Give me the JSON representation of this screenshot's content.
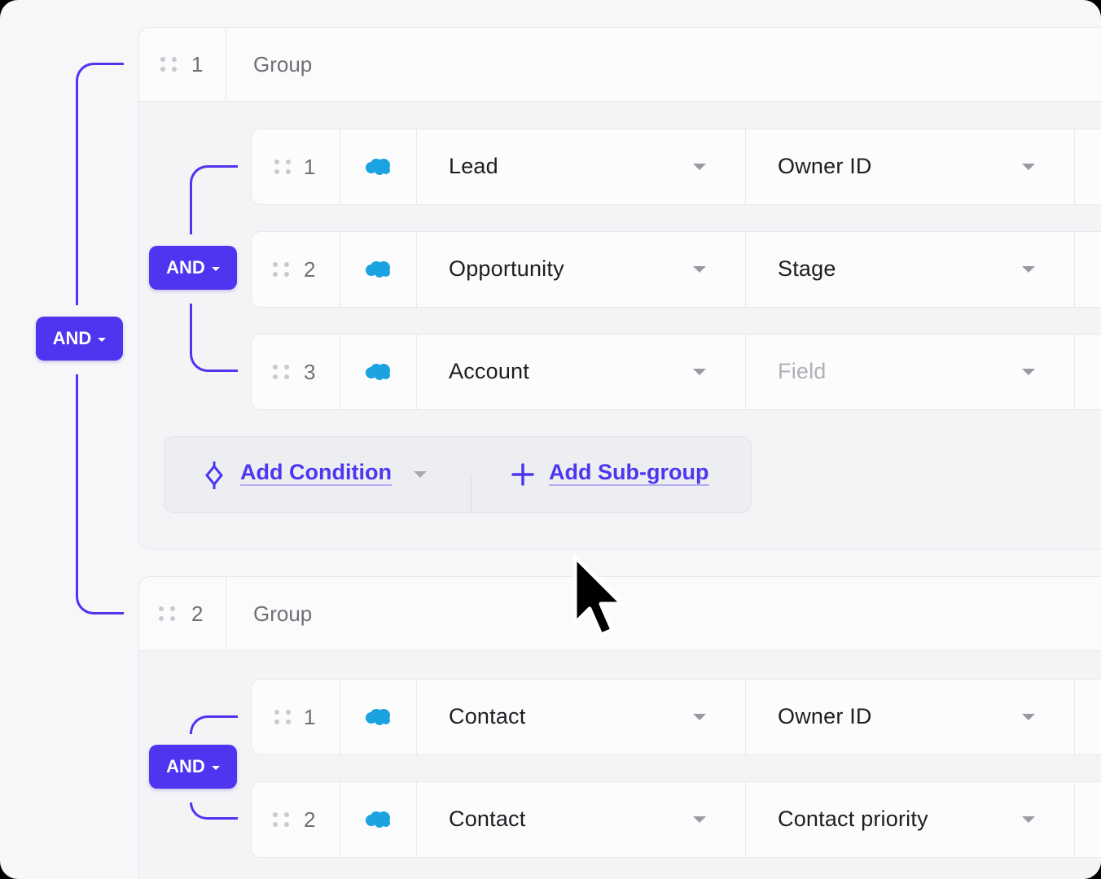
{
  "operators": {
    "root": "AND",
    "group1": "AND",
    "group2": "AND"
  },
  "groups": [
    {
      "number": "1",
      "label": "Group",
      "conditions": [
        {
          "number": "1",
          "object": "Lead",
          "field": "Owner ID",
          "field_is_placeholder": false
        },
        {
          "number": "2",
          "object": "Opportunity",
          "field": "Stage",
          "field_is_placeholder": false
        },
        {
          "number": "3",
          "object": "Account",
          "field": "Field",
          "field_is_placeholder": true
        }
      ],
      "actions": {
        "add_condition": "Add Condition",
        "add_subgroup": "Add Sub-group"
      }
    },
    {
      "number": "2",
      "label": "Group",
      "conditions": [
        {
          "number": "1",
          "object": "Contact",
          "field": "Owner ID",
          "field_is_placeholder": false
        },
        {
          "number": "2",
          "object": "Contact",
          "field": "Contact priority",
          "field_is_placeholder": false
        }
      ]
    }
  ],
  "icons": {
    "condition_source": "salesforce-cloud-icon",
    "drag_handle": "drag-handle-icon",
    "add_condition": "diamond-node-icon",
    "add_subgroup": "plus-icon",
    "dropdown": "chevron-down-icon"
  },
  "colors": {
    "accent": "#4f35f0",
    "salesforce": "#1aa3e0",
    "text": "#1d1d22",
    "muted": "#6f6f78",
    "placeholder": "#b0b0b8"
  }
}
